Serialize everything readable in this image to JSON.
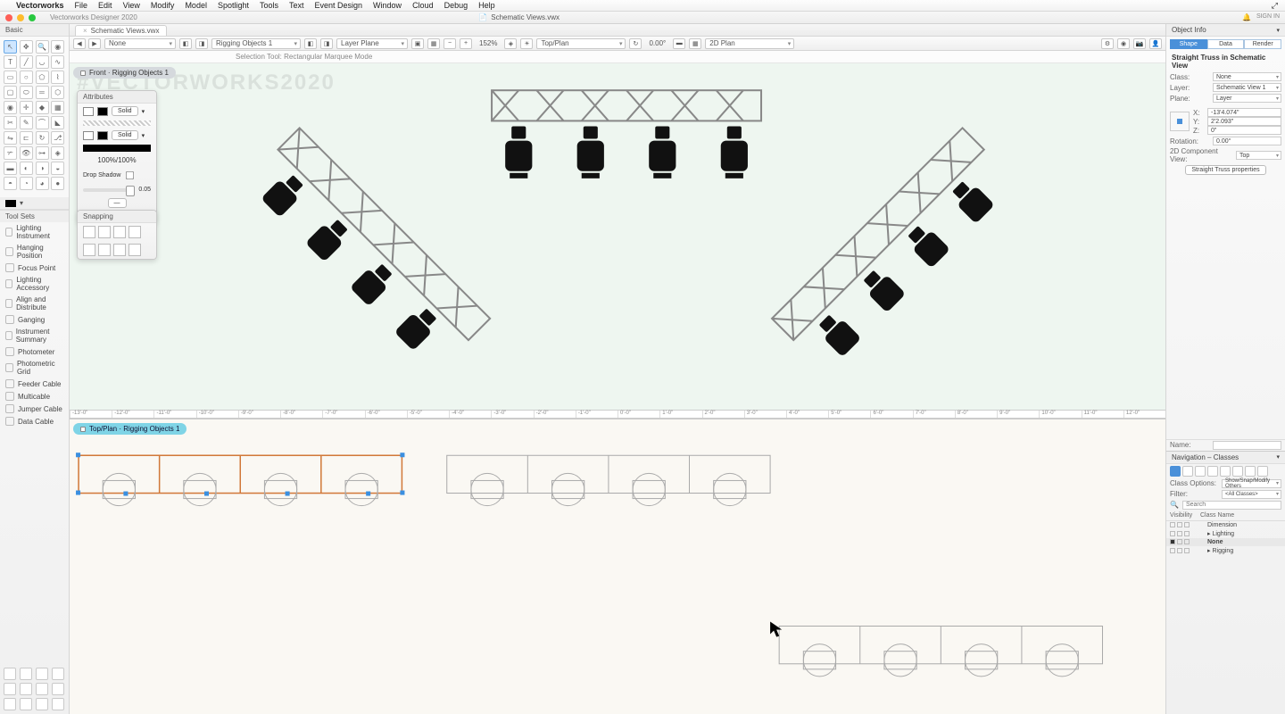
{
  "menubar": {
    "app": "Vectorworks",
    "items": [
      "File",
      "Edit",
      "View",
      "Modify",
      "Model",
      "Spotlight",
      "Tools",
      "Text",
      "Event Design",
      "Window",
      "Cloud",
      "Debug",
      "Help"
    ],
    "signin": "SIGN IN"
  },
  "titlebar": {
    "title": "Vectorworks Designer 2020",
    "document": "Schematic Views.vwx"
  },
  "tabstrip": {
    "tab1": "Schematic Views.vwx"
  },
  "viewbar": {
    "class_label": "None",
    "layer_label": "Rigging Objects 1",
    "plane_label": "Layer Plane",
    "zoom": "152%",
    "view_label": "Top/Plan",
    "rotation": "0.00°",
    "render_label": "2D Plan"
  },
  "modebar": {
    "hint": "Selection Tool: Rectangular Marquee Mode"
  },
  "watermark": "#VECTORWORKS2020",
  "basic_panel": {
    "title": "Basic"
  },
  "toolsets": {
    "title": "Tool Sets",
    "items": [
      "Lighting Instrument",
      "Hanging Position",
      "Focus Point",
      "Lighting Accessory",
      "Align and Distribute",
      "Ganging",
      "Instrument Summary",
      "Photometer",
      "Photometric Grid",
      "Feeder Cable",
      "Multicable",
      "Jumper Cable",
      "Data Cable"
    ]
  },
  "attributes": {
    "title": "Attributes",
    "fill": "Solid",
    "pen": "Solid",
    "opacity": "100%/100%",
    "shadow_label": "Drop Shadow",
    "shadow_value": "0.05"
  },
  "snapping": {
    "title": "Snapping"
  },
  "view_badges": {
    "front": "Front · Rigging Objects 1",
    "top": "Top/Plan · Rigging Objects 1"
  },
  "object_info": {
    "title": "Object Info",
    "tabs": [
      "Shape",
      "Data",
      "Render"
    ],
    "selection": "Straight Truss in Schematic View",
    "rows": {
      "class_label": "Class:",
      "class_value": "None",
      "layer_label": "Layer:",
      "layer_value": "Schematic View 1",
      "plane_label": "Plane:",
      "plane_value": "Layer",
      "x_label": "X:",
      "x_value": "-13'4.074\"",
      "y_label": "Y:",
      "y_value": "2'2.093\"",
      "z_label": "Z:",
      "z_value": "0\"",
      "rot_label": "Rotation:",
      "rot_value": "0.00°",
      "comp_label": "2D Component View:",
      "comp_value": "Top",
      "props": "Straight Truss properties"
    },
    "name_label": "Name:"
  },
  "navigation": {
    "title": "Navigation – Classes",
    "class_options_label": "Class Options:",
    "class_options_value": "Show/Snap/Modify Others",
    "filter_label": "Filter:",
    "filter_value": "<All Classes>",
    "search_placeholder": "Search",
    "col_vis": "Visibility",
    "col_name": "Class Name",
    "rows": [
      "Dimension",
      "Lighting",
      "None",
      "Rigging"
    ]
  },
  "ruler_ticks": [
    "-13'-0\"",
    "-12'-0\"",
    "-11'-0\"",
    "-10'-0\"",
    "-9'-0\"",
    "-8'-0\"",
    "-7'-0\"",
    "-6'-0\"",
    "-5'-0\"",
    "-4'-0\"",
    "-3'-0\"",
    "-2'-0\"",
    "-1'-0\"",
    "0'-0\"",
    "1'-0\"",
    "2'-0\"",
    "3'-0\"",
    "4'-0\"",
    "5'-0\"",
    "6'-0\"",
    "7'-0\"",
    "8'-0\"",
    "9'-0\"",
    "10'-0\"",
    "11'-0\"",
    "12'-0\""
  ]
}
